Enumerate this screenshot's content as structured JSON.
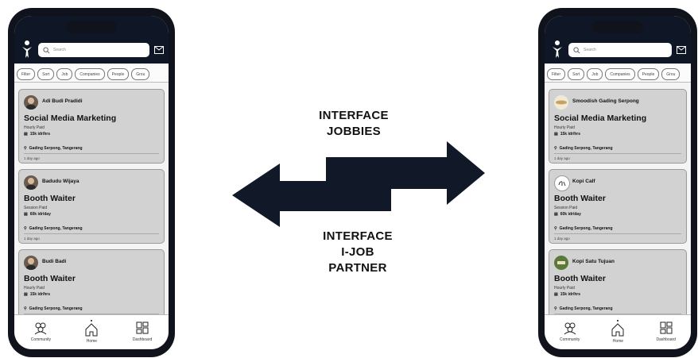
{
  "search": {
    "placeholder": "Search"
  },
  "filters": [
    "Filter",
    "Sort",
    "Job",
    "Companies",
    "People",
    "Grou"
  ],
  "nav": {
    "community": "Community",
    "home": "Home",
    "dashboard": "Dashboard"
  },
  "labels": {
    "top_line1": "INTERFACE",
    "top_line2": "JOBBIES",
    "bottom_line1": "INTERFACE",
    "bottom_line2": "I-JOB",
    "bottom_line3": "PARTNER"
  },
  "left_cards": [
    {
      "name": "Adi Budi Pradidi",
      "title": "Social Media Marketing",
      "paid": "Hourly Paid",
      "rate": "15k idr/hrs",
      "location": "Gading Serpong, Tangerang",
      "ago": "1 day ago"
    },
    {
      "name": "Badudu Wijaya",
      "title": "Booth Waiter",
      "paid": "Session Paid",
      "rate": "60k idr/day",
      "location": "Gading Serpong, Tangerang",
      "ago": "1 day ago"
    },
    {
      "name": "Budi Badi",
      "title": "Booth Waiter",
      "paid": "Hourly Paid",
      "rate": "15k idr/hrs",
      "location": "Gading Serpong, Tangerang",
      "ago": "1 day ago"
    }
  ],
  "right_cards": [
    {
      "name": "Smoodish Gading Serpong",
      "title": "Social Media Marketing",
      "paid": "Hourly Paid",
      "rate": "15k idr/hrs",
      "location": "Gading Serpong, Tangerang",
      "ago": "1 day ago"
    },
    {
      "name": "Kopi Calf",
      "title": "Booth Waiter",
      "paid": "Session Paid",
      "rate": "60k idr/day",
      "location": "Gading Serpong, Tangerang",
      "ago": "1 day ago"
    },
    {
      "name": "Kopi Satu Tujuan",
      "title": "Booth Waiter",
      "paid": "Hourly Paid",
      "rate": "15k idr/hrs",
      "location": "Gading Serpong, Tangerang",
      "ago": "1 day ago"
    }
  ],
  "colors": {
    "topbar": "#0f1726",
    "arrow": "#111827",
    "card": "#d2d2d2"
  }
}
